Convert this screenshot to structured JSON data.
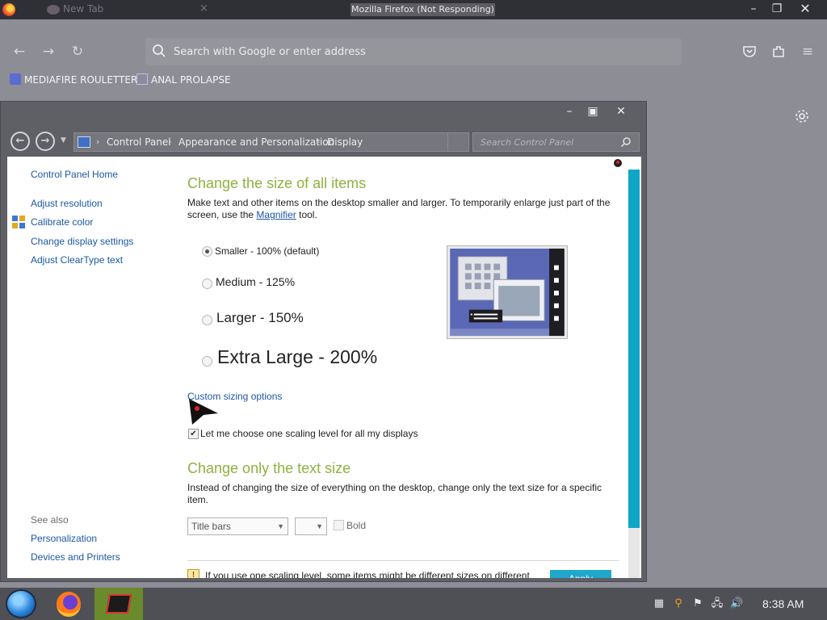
{
  "firefox": {
    "window_title": "Mozilla Firefox (Not Responding)",
    "tab_title": "New Tab",
    "url_placeholder": "Search with Google or enter address",
    "bookmarks": [
      {
        "label": "MEDIAFIRE ROULETTER",
        "icon": "mediafire-icon"
      },
      {
        "label": "ANAL PROLAPSE",
        "icon": "folder-icon"
      }
    ]
  },
  "control_panel": {
    "breadcrumbs": [
      "Control Panel",
      "Appearance and Personalization",
      "Display"
    ],
    "search_placeholder": "Search Control Panel",
    "sidebar": {
      "home": "Control Panel Home",
      "links": [
        "Adjust resolution",
        "Calibrate color",
        "Change display settings",
        "Adjust ClearType text"
      ],
      "see_also_label": "See also",
      "see_also": [
        "Personalization",
        "Devices and Printers"
      ]
    },
    "main": {
      "heading1": "Change the size of all items",
      "description1": "Make text and other items on the desktop smaller and larger. To temporarily enlarge just part of the screen, use the",
      "magnifier_link": "Magnifier",
      "description1_end": "tool.",
      "size_options": [
        {
          "label": "Smaller - 100% (default)",
          "selected": true
        },
        {
          "label": "Medium - 125%",
          "selected": false
        },
        {
          "label": "Larger - 150%",
          "selected": false
        },
        {
          "label": "Extra Large - 200%",
          "selected": false
        }
      ],
      "custom_sizing": "Custom sizing options",
      "scaling_checkbox": "Let me choose one scaling level for all my displays",
      "scaling_checked": true,
      "heading2": "Change only the text size",
      "description2": "Instead of changing the size of everything on the desktop, change only the text size for a specific item.",
      "item_select": "Title bars",
      "size_select": "",
      "bold_label": "Bold",
      "info_text": "If you use one scaling level, some items might be different sizes on different",
      "apply_label": "Apply"
    }
  },
  "taskbar": {
    "clock": "8:38 AM"
  },
  "colors": {
    "heading_green": "#8eb13f",
    "link_blue": "#1c57a3",
    "scrollbar_teal": "#0ea6c7",
    "apply_blue": "#1fa7cc"
  }
}
